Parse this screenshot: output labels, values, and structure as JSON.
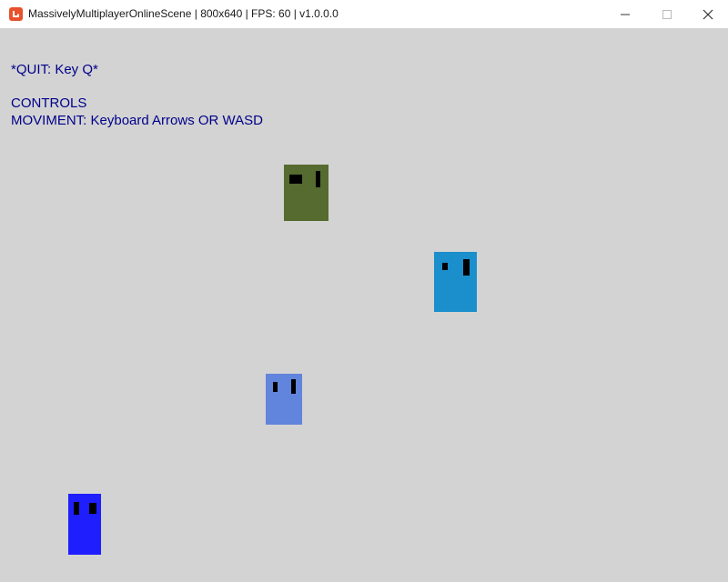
{
  "window": {
    "title": "MassivelyMultiplayerOnlineScene | 800x640 | FPS: 60 | v1.0.0.0",
    "app_icon": "monogame-logo-icon",
    "buttons": [
      "minimize-icon",
      "maximize-icon",
      "close-icon"
    ]
  },
  "hud": {
    "quit": "*QUIT: Key Q*",
    "controls_heading": "CONTROLS",
    "movement": "MOVIMENT: Keyboard Arrows OR WASD",
    "text_color": "#00008b"
  },
  "scene": {
    "background": "#d3d3d3",
    "players": [
      {
        "name": "player-green",
        "color": "#556b2f"
      },
      {
        "name": "player-cyan",
        "color": "#1a8fcc"
      },
      {
        "name": "player-cornflower",
        "color": "#6184dc"
      },
      {
        "name": "player-blue",
        "color": "#1e1eff"
      }
    ]
  }
}
